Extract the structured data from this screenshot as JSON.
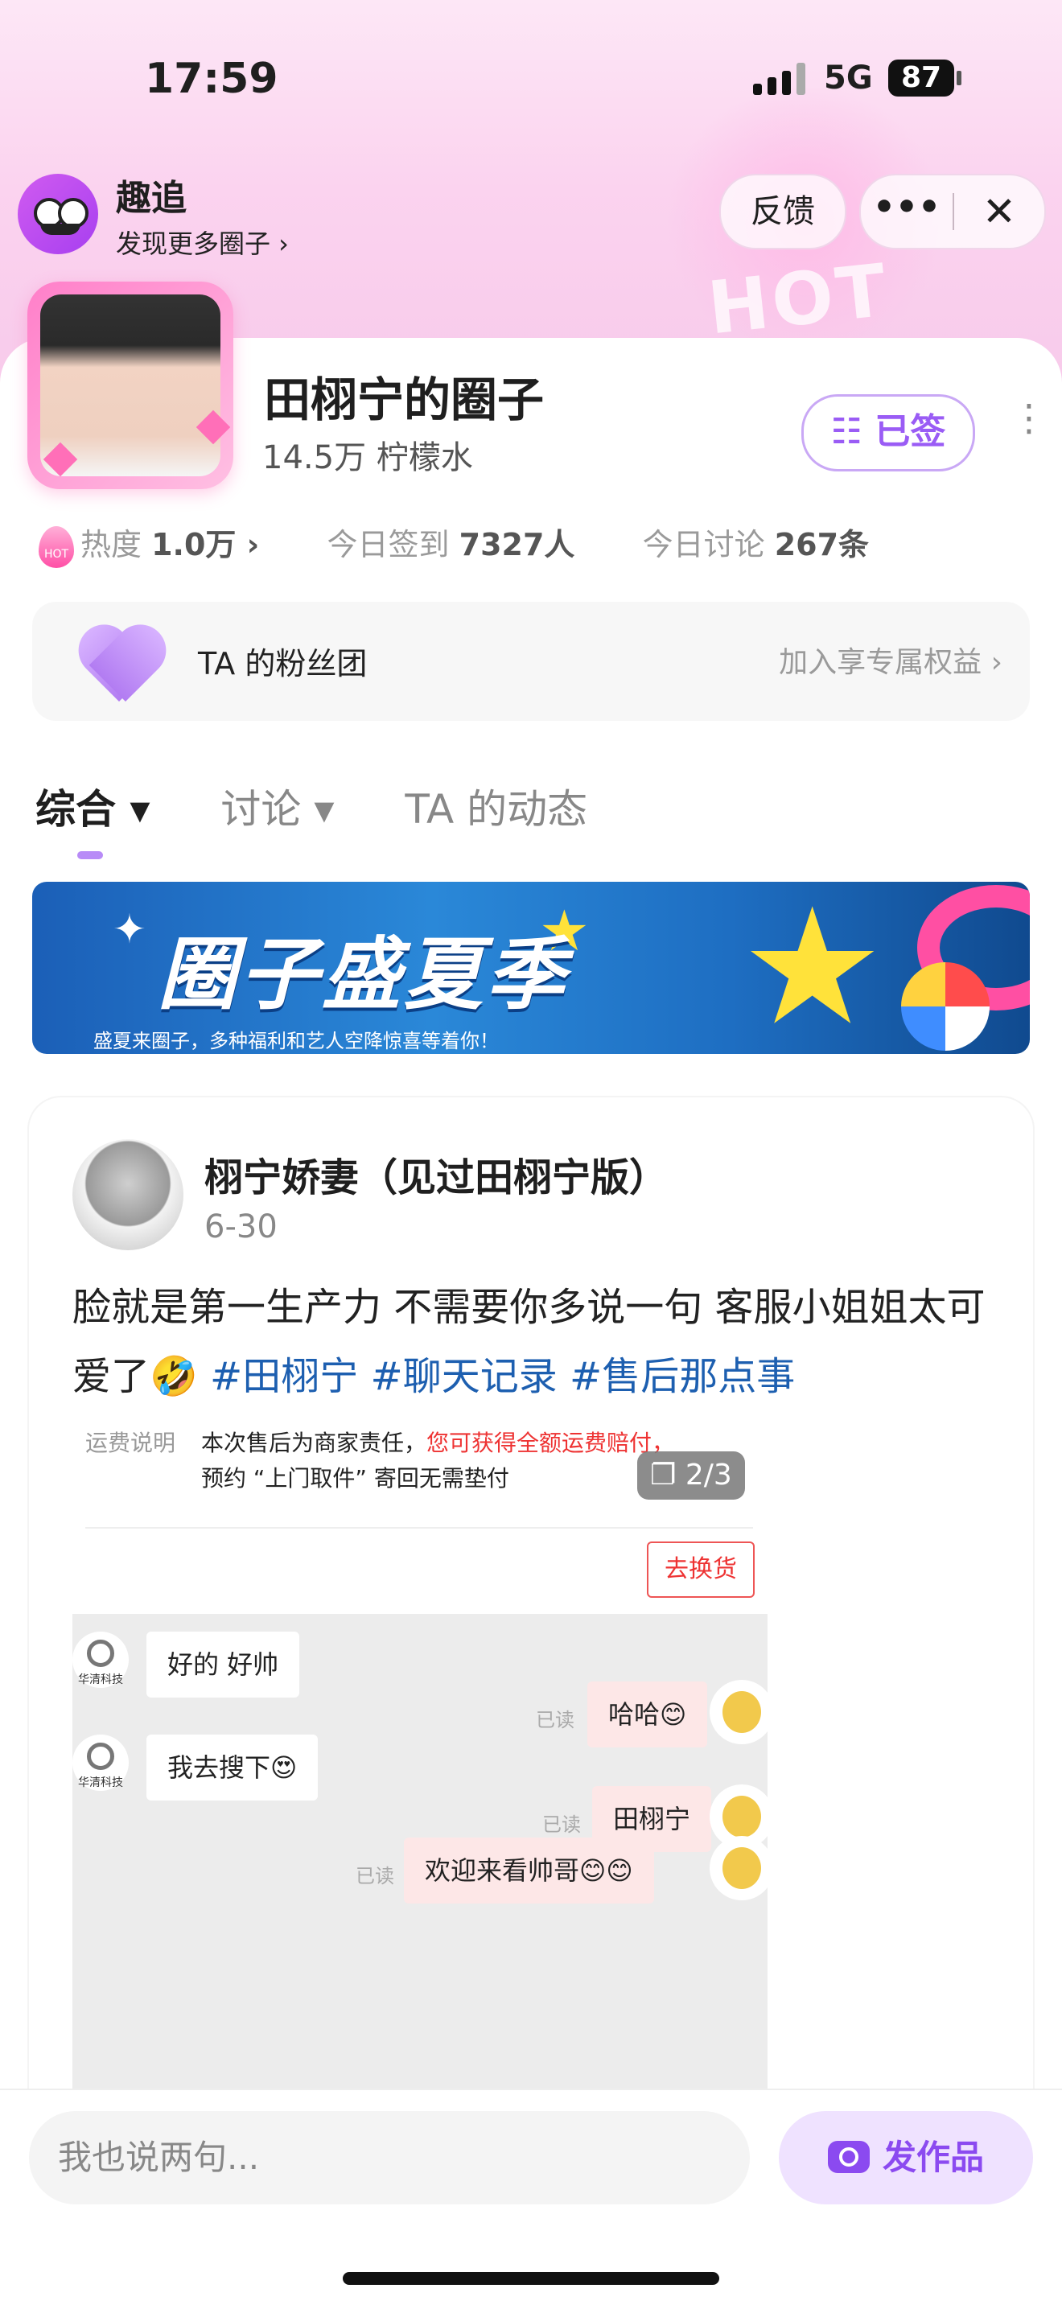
{
  "status": {
    "time": "17:59",
    "network": "5G",
    "battery": "87"
  },
  "app": {
    "name": "趣追",
    "discover": "发现更多圈子 ›",
    "feedback": "反馈",
    "more": "•••",
    "close": "✕",
    "hot_word": "HOT"
  },
  "circle": {
    "title": "田栩宁的圈子",
    "members": "14.5万 柠檬水",
    "signed": "☷ 已签",
    "menu": "⋮",
    "stats": {
      "heat_icon": "HOT",
      "heat_label": "热度",
      "heat_value": "1.0万 ›",
      "checkin_label": "今日签到",
      "checkin_value": "7327人",
      "discuss_label": "今日讨论",
      "discuss_value": "267条"
    },
    "fanclub": {
      "label": "TA 的粉丝团",
      "cta": "加入享专属权益 ›"
    }
  },
  "tabs": [
    {
      "label": "综合 ▾"
    },
    {
      "label": "讨论 ▾"
    },
    {
      "label": "TA 的动态"
    }
  ],
  "banner": {
    "title": "圈子盛夏季",
    "subtitle": "盛夏来圈子，多种福利和艺人空降惊喜等着你！"
  },
  "post": {
    "author": "栩宁娇妻（见过田栩宁版）",
    "date": "6-30",
    "text": "脸就是第一生产力 不需要你多说一句 客服小姐姐太可爱了🤣 ",
    "tags": [
      "#田栩宁",
      "#聊天记录",
      "#售后那点事"
    ],
    "image_counter": "❐ 2/3",
    "screenshot": {
      "fee_label": "运费说明",
      "fee_text_1": "本次售后为商家责任，",
      "fee_text_red": "您可获得全额运费赔付，",
      "fee_text_2": "预约 “上门取件” 寄回无需垫付",
      "exchange": "去换货",
      "bot_name": "华清科技",
      "read": "已读",
      "messages": [
        {
          "from": "shop",
          "text": "好的 好帅"
        },
        {
          "from": "me",
          "text": "哈哈😊"
        },
        {
          "from": "shop",
          "text": "我去搜下😍"
        },
        {
          "from": "me",
          "text": "田栩宁"
        },
        {
          "from": "me",
          "text": "欢迎来看帅哥😊😊"
        }
      ]
    }
  },
  "bottom": {
    "placeholder": "我也说两句...",
    "publish": "发作品"
  }
}
